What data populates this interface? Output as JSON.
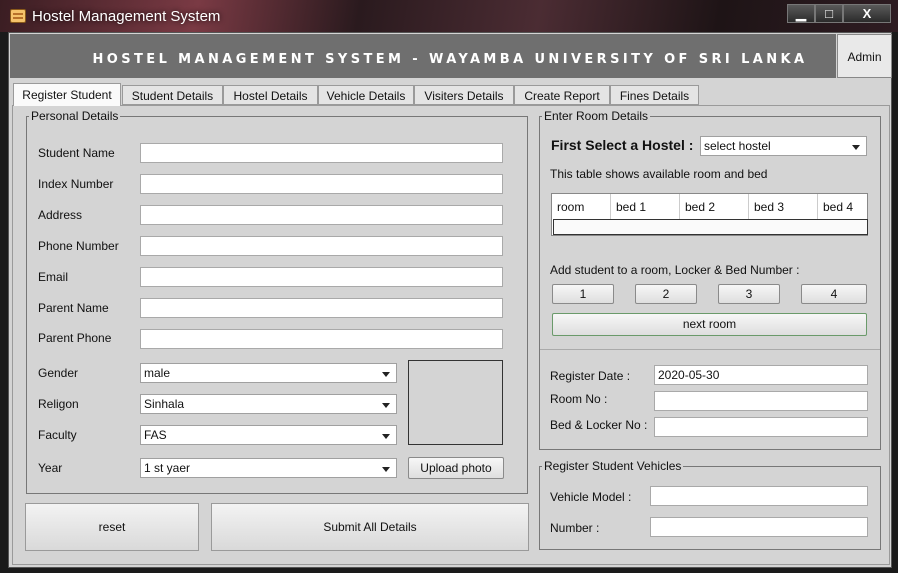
{
  "window": {
    "title": "Hostel Management System",
    "controls": {
      "minimize": "▁",
      "maximize": "□",
      "close": "X"
    }
  },
  "header": {
    "banner": "HOSTEL MANAGEMENT SYSTEM - WAYAMBA UNIVERSITY OF SRI LANKA",
    "admin_button": "Admin"
  },
  "tabs": [
    "Register Student",
    "Student Details",
    "Hostel Details",
    "Vehicle Details",
    "Visiters Details",
    "Create Report",
    "Fines Details"
  ],
  "personal": {
    "title": "Personal Details",
    "labels": {
      "student_name": "Student Name",
      "index_number": "Index Number",
      "address": "Address",
      "phone_number": "Phone Number",
      "email": "Email",
      "parent_name": "Parent Name",
      "parent_phone": "Parent Phone",
      "gender": "Gender",
      "religion": "Religon",
      "faculty": "Faculty",
      "year": "Year"
    },
    "values": {
      "gender": "male",
      "religion": "Sinhala",
      "faculty": "FAS",
      "year": "1 st yaer"
    },
    "upload_button": "Upload photo"
  },
  "actions": {
    "reset": "reset",
    "submit": "Submit All Details"
  },
  "room": {
    "title": "Enter Room Details",
    "select_label": "First Select a Hostel :",
    "select_value": "select hostel",
    "info": "This table shows available room and bed",
    "columns": [
      "room",
      "bed 1",
      "bed 2",
      "bed 3",
      "bed 4"
    ],
    "add_label": "Add student to a room, Locker & Bed Number :",
    "bed_buttons": [
      "1",
      "2",
      "3",
      "4"
    ],
    "next_room": "next room",
    "register_date_label": "Register Date :",
    "register_date_value": "2020-05-30",
    "room_no_label": "Room No :",
    "bed_locker_label": "Bed & Locker No :"
  },
  "vehicles": {
    "title": "Register Student Vehicles",
    "model_label": "Vehicle Model  :",
    "number_label": "Number   :"
  }
}
